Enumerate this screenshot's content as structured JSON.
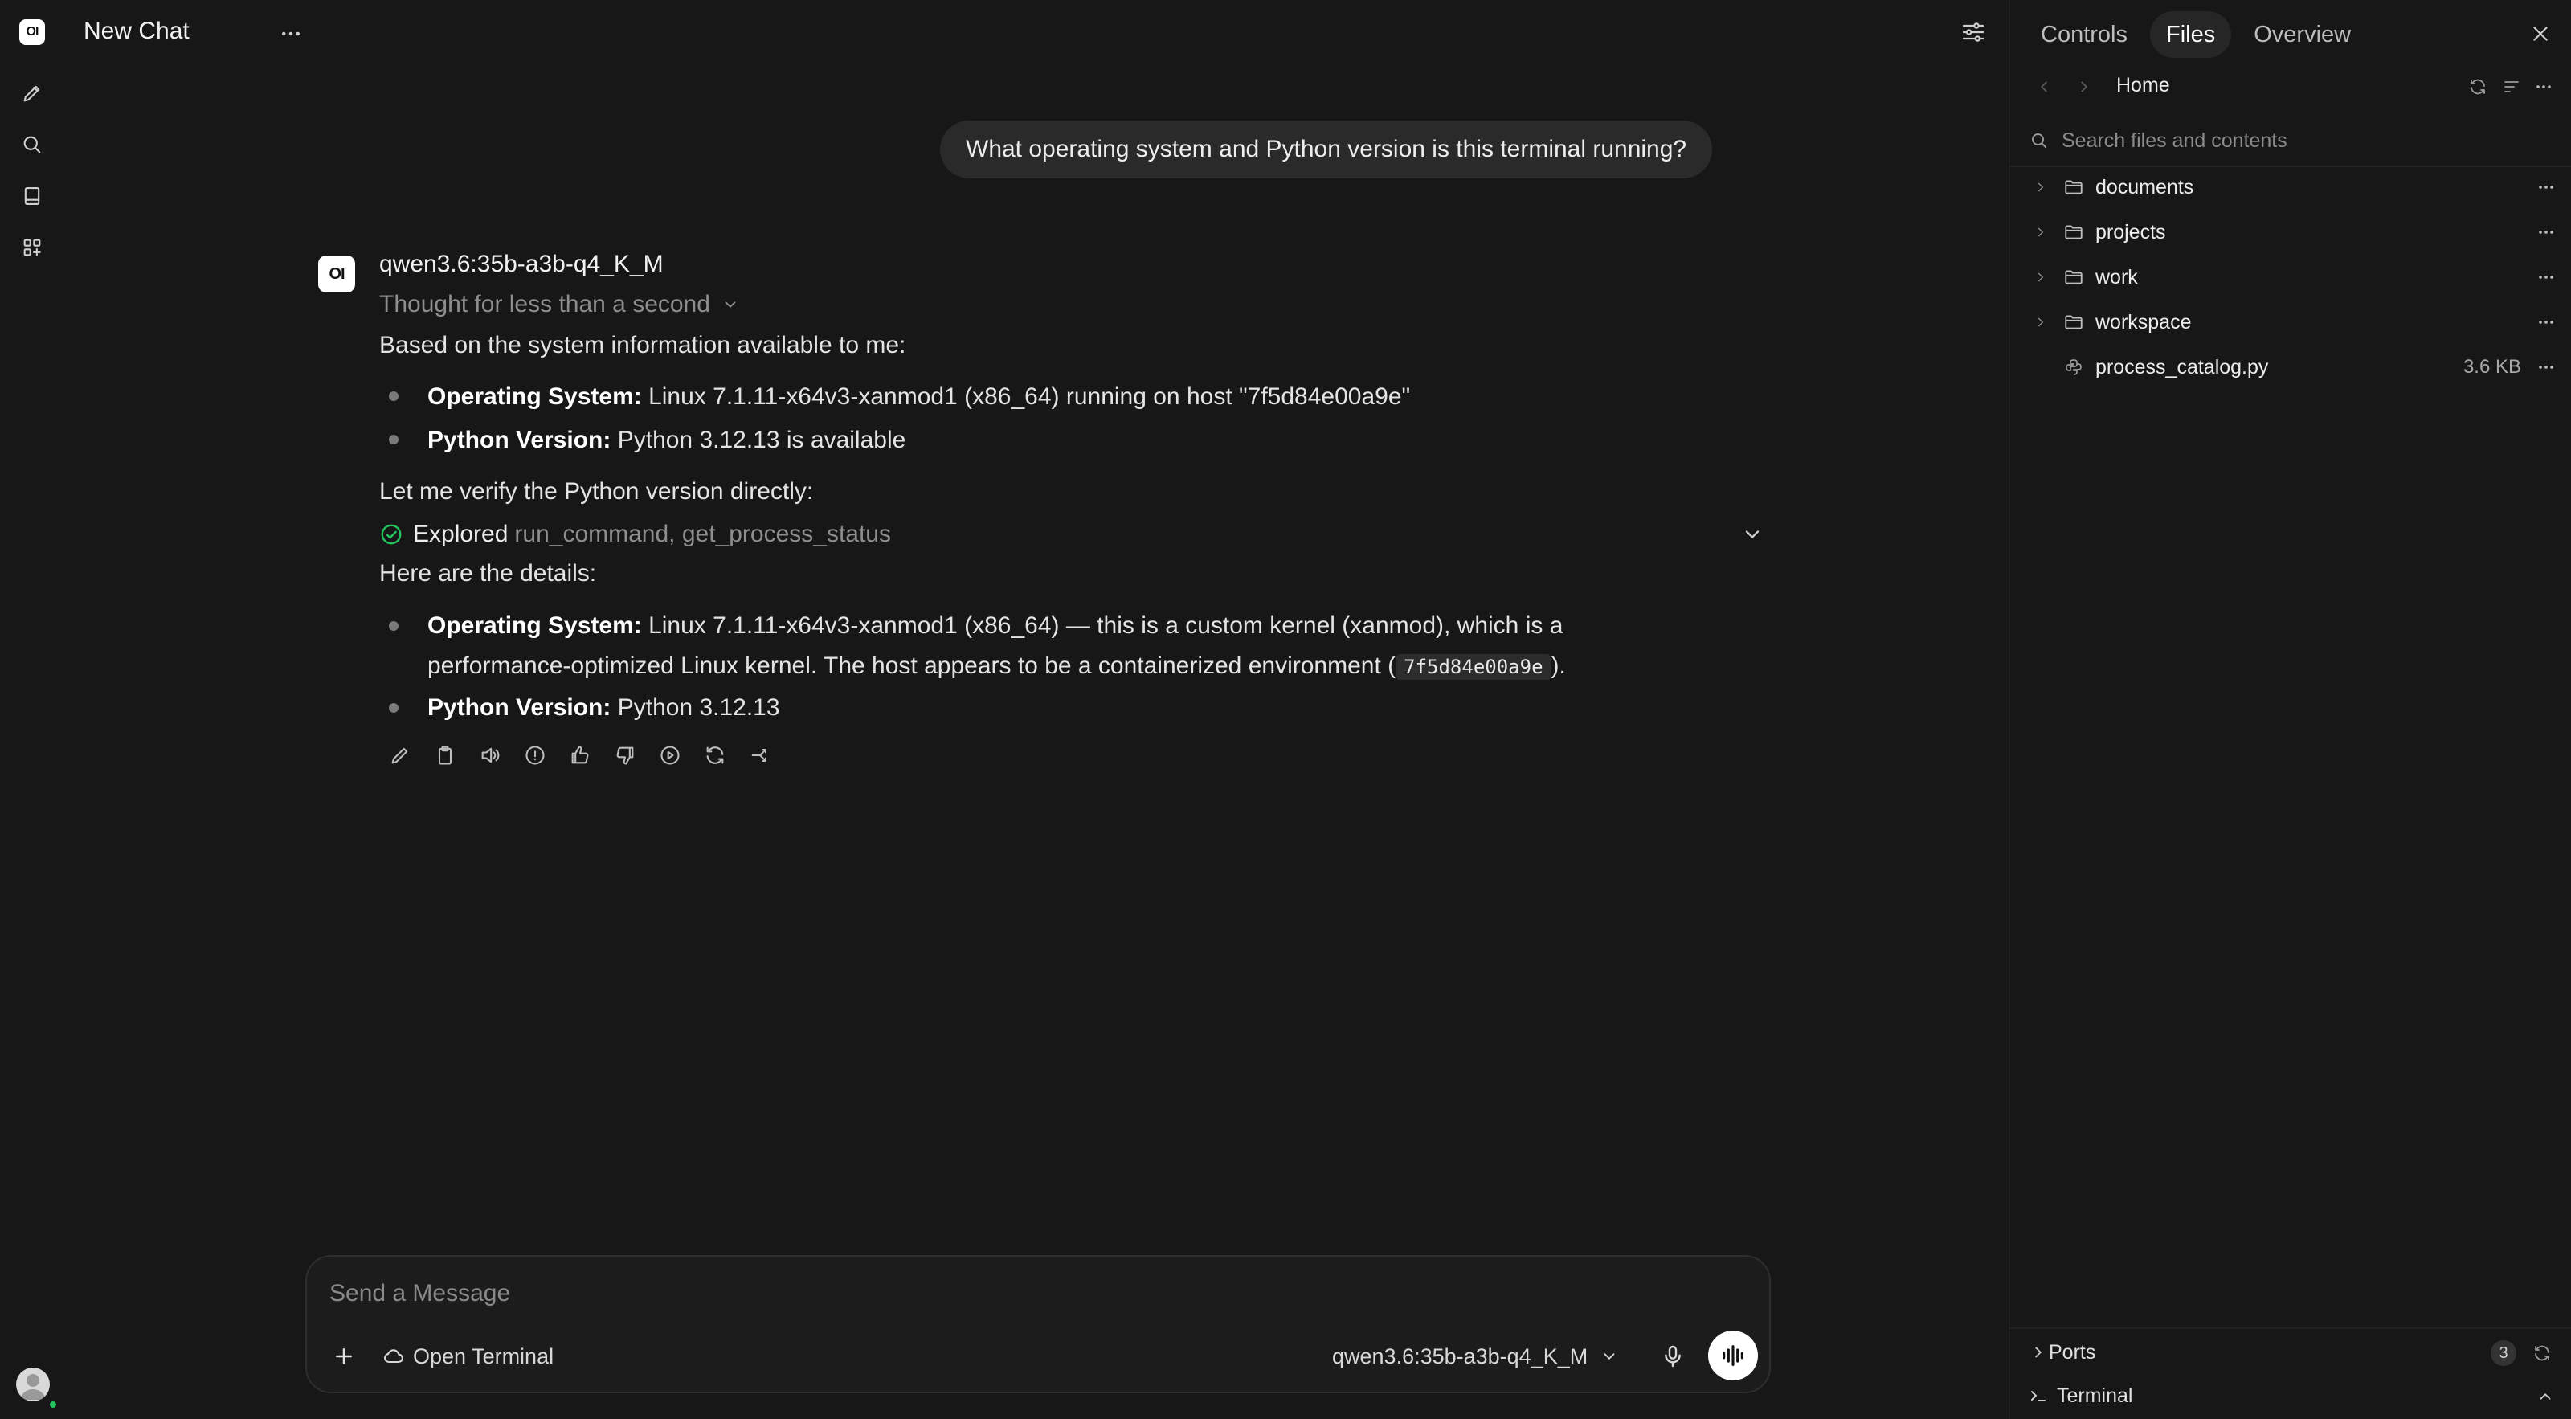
{
  "rail": {
    "logo": "OI",
    "items": [
      {
        "name": "new-chat",
        "icon": "pencil-icon"
      },
      {
        "name": "search",
        "icon": "search-icon"
      },
      {
        "name": "notes",
        "icon": "notebook-icon"
      },
      {
        "name": "workspace",
        "icon": "grid-icon"
      }
    ]
  },
  "header": {
    "title": "New Chat"
  },
  "chat": {
    "user_message": "What operating system and Python version is this terminal running?",
    "assistant": {
      "avatar_text": "OI",
      "model": "qwen3.6:35b-a3b-q4_K_M",
      "thought": "Thought for less than a second",
      "intro": "Based on the system information available to me:",
      "list1": [
        {
          "label": "Operating System:",
          "text": "Linux 7.1.11-x64v3-xanmod1 (x86_64) running on host \"7f5d84e00a9e\""
        },
        {
          "label": "Python Version:",
          "text": "Python 3.12.13 is available"
        }
      ],
      "verify": "Let me verify the Python version directly:",
      "explored_label": "Explored",
      "explored_tools": "run_command, get_process_status",
      "details_intro": "Here are the details:",
      "list2": {
        "os_label": "Operating System:",
        "os_text_line1": "Linux 7.1.11-x64v3-xanmod1 (x86_64) — this is a custom kernel (xanmod), which is a",
        "os_text_line2a": "performance-optimized Linux kernel. The host appears to be a containerized environment (",
        "os_code": "7f5d84e00a9e",
        "os_text_line2b": ").",
        "py_label": "Python Version:",
        "py_text": "Python 3.12.13"
      }
    },
    "actions": [
      "edit-icon",
      "copy-icon",
      "speaker-icon",
      "info-icon",
      "thumbs-up-icon",
      "thumbs-down-icon",
      "continue-icon",
      "regenerate-icon",
      "branch-icon"
    ]
  },
  "composer": {
    "placeholder": "Send a Message",
    "open_terminal": "Open Terminal",
    "model": "qwen3.6:35b-a3b-q4_K_M"
  },
  "panel": {
    "tabs": [
      {
        "label": "Controls",
        "active": false
      },
      {
        "label": "Files",
        "active": true
      },
      {
        "label": "Overview",
        "active": false
      }
    ],
    "breadcrumb": "Home",
    "search_placeholder": "Search files and contents",
    "files": [
      {
        "name": "documents",
        "type": "folder",
        "size": ""
      },
      {
        "name": "projects",
        "type": "folder",
        "size": ""
      },
      {
        "name": "work",
        "type": "folder",
        "size": ""
      },
      {
        "name": "workspace",
        "type": "folder",
        "size": ""
      },
      {
        "name": "process_catalog.py",
        "type": "file",
        "size": "3.6 KB"
      }
    ],
    "ports_label": "Ports",
    "ports_count": "3",
    "terminal_label": "Terminal"
  },
  "colors": {
    "background": "#171717",
    "bubble": "#2a2a2a",
    "success": "#22c55e",
    "muted": "#8e8e8e"
  }
}
